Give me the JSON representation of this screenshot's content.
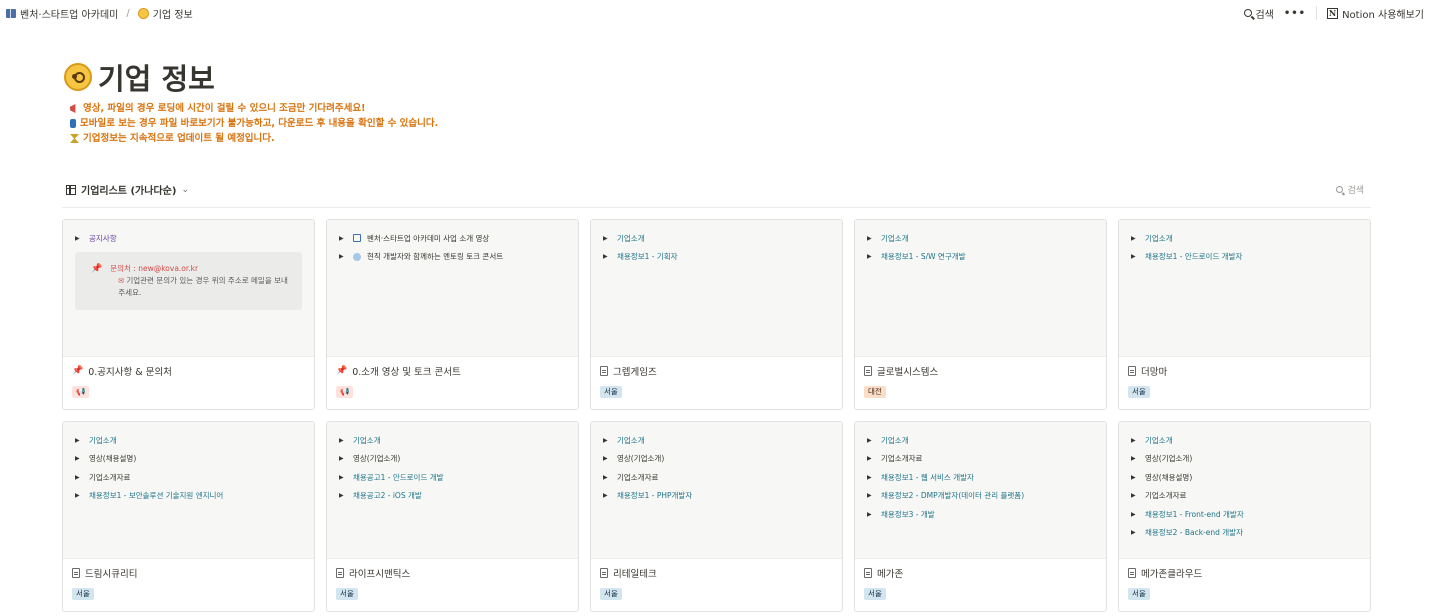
{
  "breadcrumb": {
    "workspace": "벤처·스타트업 아카데미",
    "separator": "/",
    "page": "기업 정보"
  },
  "topbar": {
    "search": "검색",
    "more": "•••",
    "notion_try": "Notion 사용해보기"
  },
  "page": {
    "title": "기업 정보",
    "notices": [
      "영상, 파일의 경우 로딩에 시간이 걸릴 수 있으니 조금만 기다려주세요!",
      "모바일로 보는 경우 파일 바로보기가 불가능하고, 다운로드 후 내용을 확인할 수 있습니다.",
      "기업정보는 지속적으로 업데이트 될 예정입니다."
    ]
  },
  "view": {
    "name": "기업리스트 (가나다순)",
    "chevron": "⌄",
    "search": "검색"
  },
  "cards": [
    {
      "title": "0.공지사항 & 문의처",
      "tag": "📢",
      "items": [
        {
          "text": "공지사항",
          "color": "#6940a5"
        }
      ],
      "callout": {
        "contact": "문의처 : new@kova.or.kr",
        "note": "기업관련 문의가 있는 경우 위의 주소로 메일을 보내주세요."
      }
    },
    {
      "title": "0.소개 영상 및 토크 콘서트",
      "tag": "📢",
      "items": [
        {
          "text": "벤처·스타트업 아카데미 사업 소개 영상",
          "color": "#37352f"
        },
        {
          "text": "현직 개발자와 함께하는 멘토링 토크 콘서트",
          "color": "#37352f"
        }
      ]
    },
    {
      "title": "그렙게임즈",
      "tag": "서울",
      "items": [
        {
          "text": "기업소개",
          "color": "#1c7389"
        },
        {
          "text": "채용정보1 - 기획자",
          "color": "#1c7389"
        }
      ]
    },
    {
      "title": "글로벌시스템스",
      "tag": "대전",
      "items": [
        {
          "text": "기업소개",
          "color": "#1c7389"
        },
        {
          "text": "채용정보1 - S/W 연구개발",
          "color": "#1c7389"
        }
      ]
    },
    {
      "title": "더망마",
      "tag": "서울",
      "items": [
        {
          "text": "기업소개",
          "color": "#1c7389"
        },
        {
          "text": "채용정보1 - 안드로이드 개발자",
          "color": "#1c7389"
        }
      ]
    },
    {
      "title": "드림시큐리티",
      "tag": "서울",
      "items": [
        {
          "text": "기업소개",
          "color": "#1c7389"
        },
        {
          "text": "영상(채용설명)",
          "color": "#37352f"
        },
        {
          "text": "기업소개자료",
          "color": "#37352f"
        },
        {
          "text": "채용정보1 - 보안솔루션 기술지원 엔지니어",
          "color": "#1c7389"
        }
      ]
    },
    {
      "title": "라이프시맨틱스",
      "tag": "서울",
      "items": [
        {
          "text": "기업소개",
          "color": "#1c7389"
        },
        {
          "text": "영상(기업소개)",
          "color": "#37352f"
        },
        {
          "text": "채용공고1 - 안드로이드 개발",
          "color": "#1c7389"
        },
        {
          "text": "채용공고2 - iOS 개발",
          "color": "#1c7389"
        }
      ]
    },
    {
      "title": "리테일테크",
      "tag": "서울",
      "items": [
        {
          "text": "기업소개",
          "color": "#1c7389"
        },
        {
          "text": "영상(기업소개)",
          "color": "#37352f"
        },
        {
          "text": "기업소개자료",
          "color": "#37352f"
        },
        {
          "text": "채용정보1 - PHP개발자",
          "color": "#1c7389"
        }
      ]
    },
    {
      "title": "메가존",
      "tag": "서울",
      "items": [
        {
          "text": "기업소개",
          "color": "#1c7389"
        },
        {
          "text": "기업소개자료",
          "color": "#37352f"
        },
        {
          "text": "채용정보1 - 웹 서비스 개발자",
          "color": "#1c7389"
        },
        {
          "text": "채용정보2 - DMP개발자(데이터 관리 플랫폼)",
          "color": "#1c7389"
        },
        {
          "text": "채용정보3 - 개발",
          "color": "#1c7389"
        }
      ]
    },
    {
      "title": "메가존클라우드",
      "tag": "서울",
      "items": [
        {
          "text": "기업소개",
          "color": "#1c7389"
        },
        {
          "text": "영상(기업소개)",
          "color": "#37352f"
        },
        {
          "text": "영상(채용설명)",
          "color": "#37352f"
        },
        {
          "text": "기업소개자료",
          "color": "#37352f"
        },
        {
          "text": "채용정보1 - Front-end 개발자",
          "color": "#1c7389"
        },
        {
          "text": "채용정보2 - Back-end 개발자",
          "color": "#1c7389"
        }
      ]
    }
  ]
}
